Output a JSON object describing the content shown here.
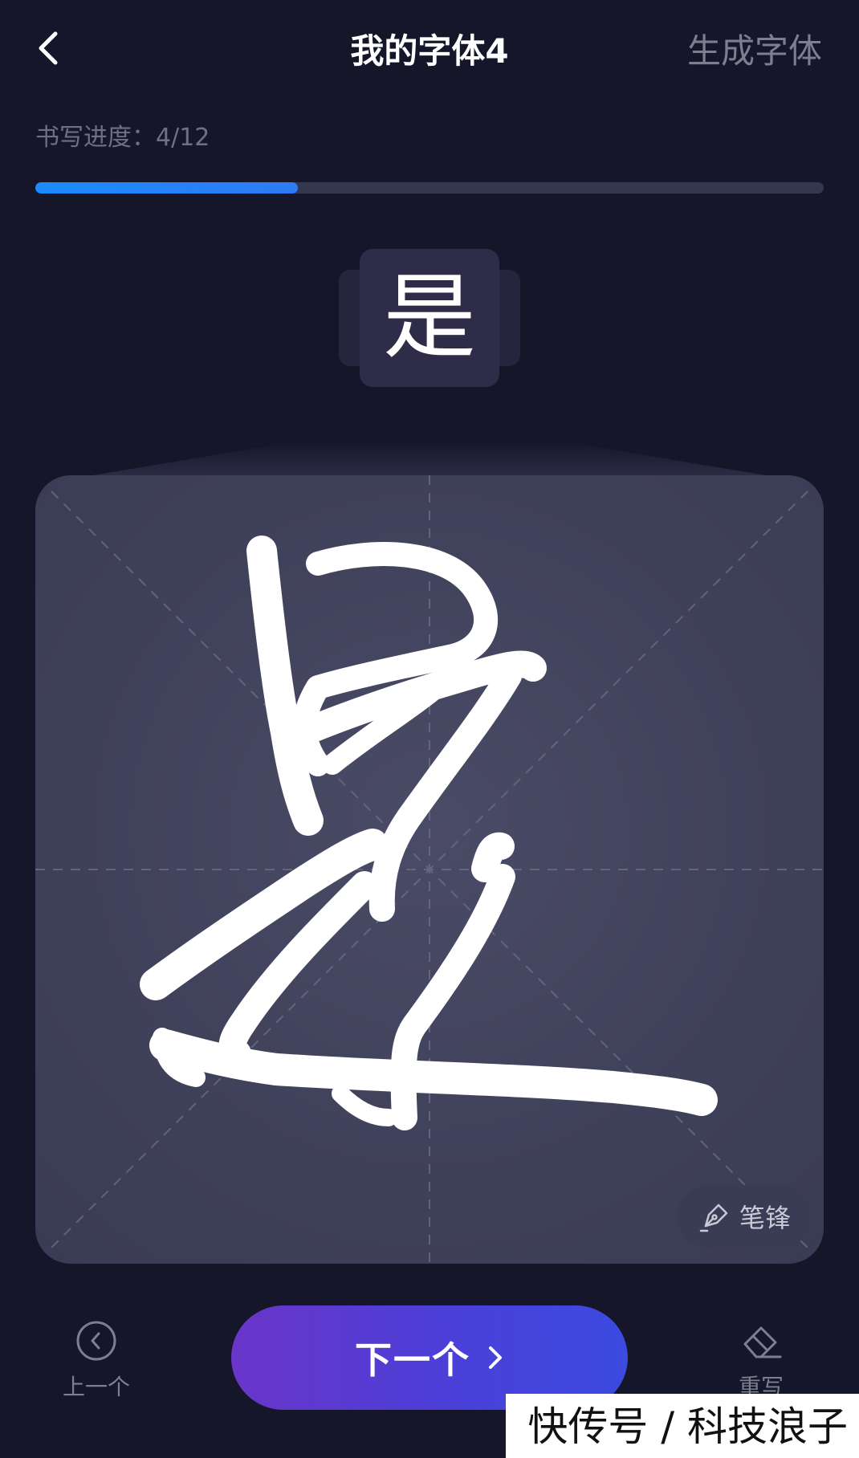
{
  "header": {
    "title": "我的字体4",
    "generate_label": "生成字体"
  },
  "progress": {
    "label": "书写进度：4/12",
    "current": 4,
    "total": 12,
    "fraction": 0.333
  },
  "current_char": "是",
  "canvas": {
    "pen_label": "笔锋"
  },
  "footer": {
    "prev_label": "上一个",
    "next_label": "下一个",
    "rewrite_label": "重写"
  },
  "watermark": "快传号 / 科技浪子",
  "colors": {
    "background": "#151629",
    "canvas": "#3f405a",
    "progress_fill": "#1a8cff",
    "next_button": "#4a3fd8",
    "muted_text": "#7d7f91"
  }
}
